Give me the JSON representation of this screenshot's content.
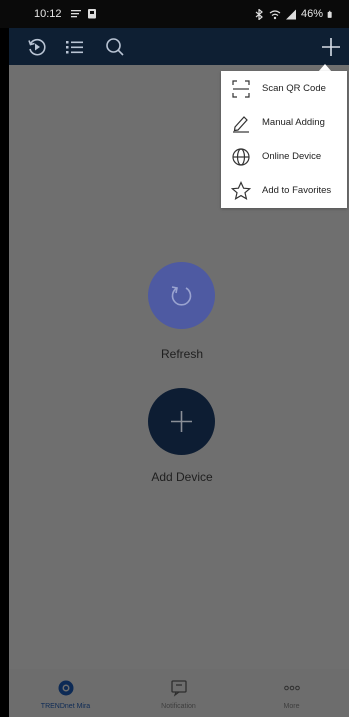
{
  "status_bar": {
    "time": "10:12",
    "battery": "46%"
  },
  "toolbar": {
    "icons": [
      "history-icon",
      "list-icon",
      "search-icon",
      "plus-icon"
    ]
  },
  "menu": {
    "items": [
      {
        "label": "Scan QR Code",
        "icon": "scan-qr-icon"
      },
      {
        "label": "Manual Adding",
        "icon": "pencil-icon"
      },
      {
        "label": "Online Device",
        "icon": "globe-icon"
      },
      {
        "label": "Add to Favorites",
        "icon": "star-icon"
      }
    ]
  },
  "main": {
    "refresh_label": "Refresh",
    "add_device_label": "Add Device"
  },
  "bottom_nav": {
    "items": [
      {
        "label": "TRENDnet Mira",
        "icon": "camera-icon",
        "active": true
      },
      {
        "label": "Notification",
        "icon": "message-icon",
        "active": false
      },
      {
        "label": "More",
        "icon": "more-icon",
        "active": false
      }
    ]
  },
  "colors": {
    "toolbar": "#0e1f33",
    "overlay": "#6f6f6f",
    "refresh_button": "#4e5aa2",
    "add_button": "#0d1d33",
    "menu_background": "#ffffff"
  }
}
